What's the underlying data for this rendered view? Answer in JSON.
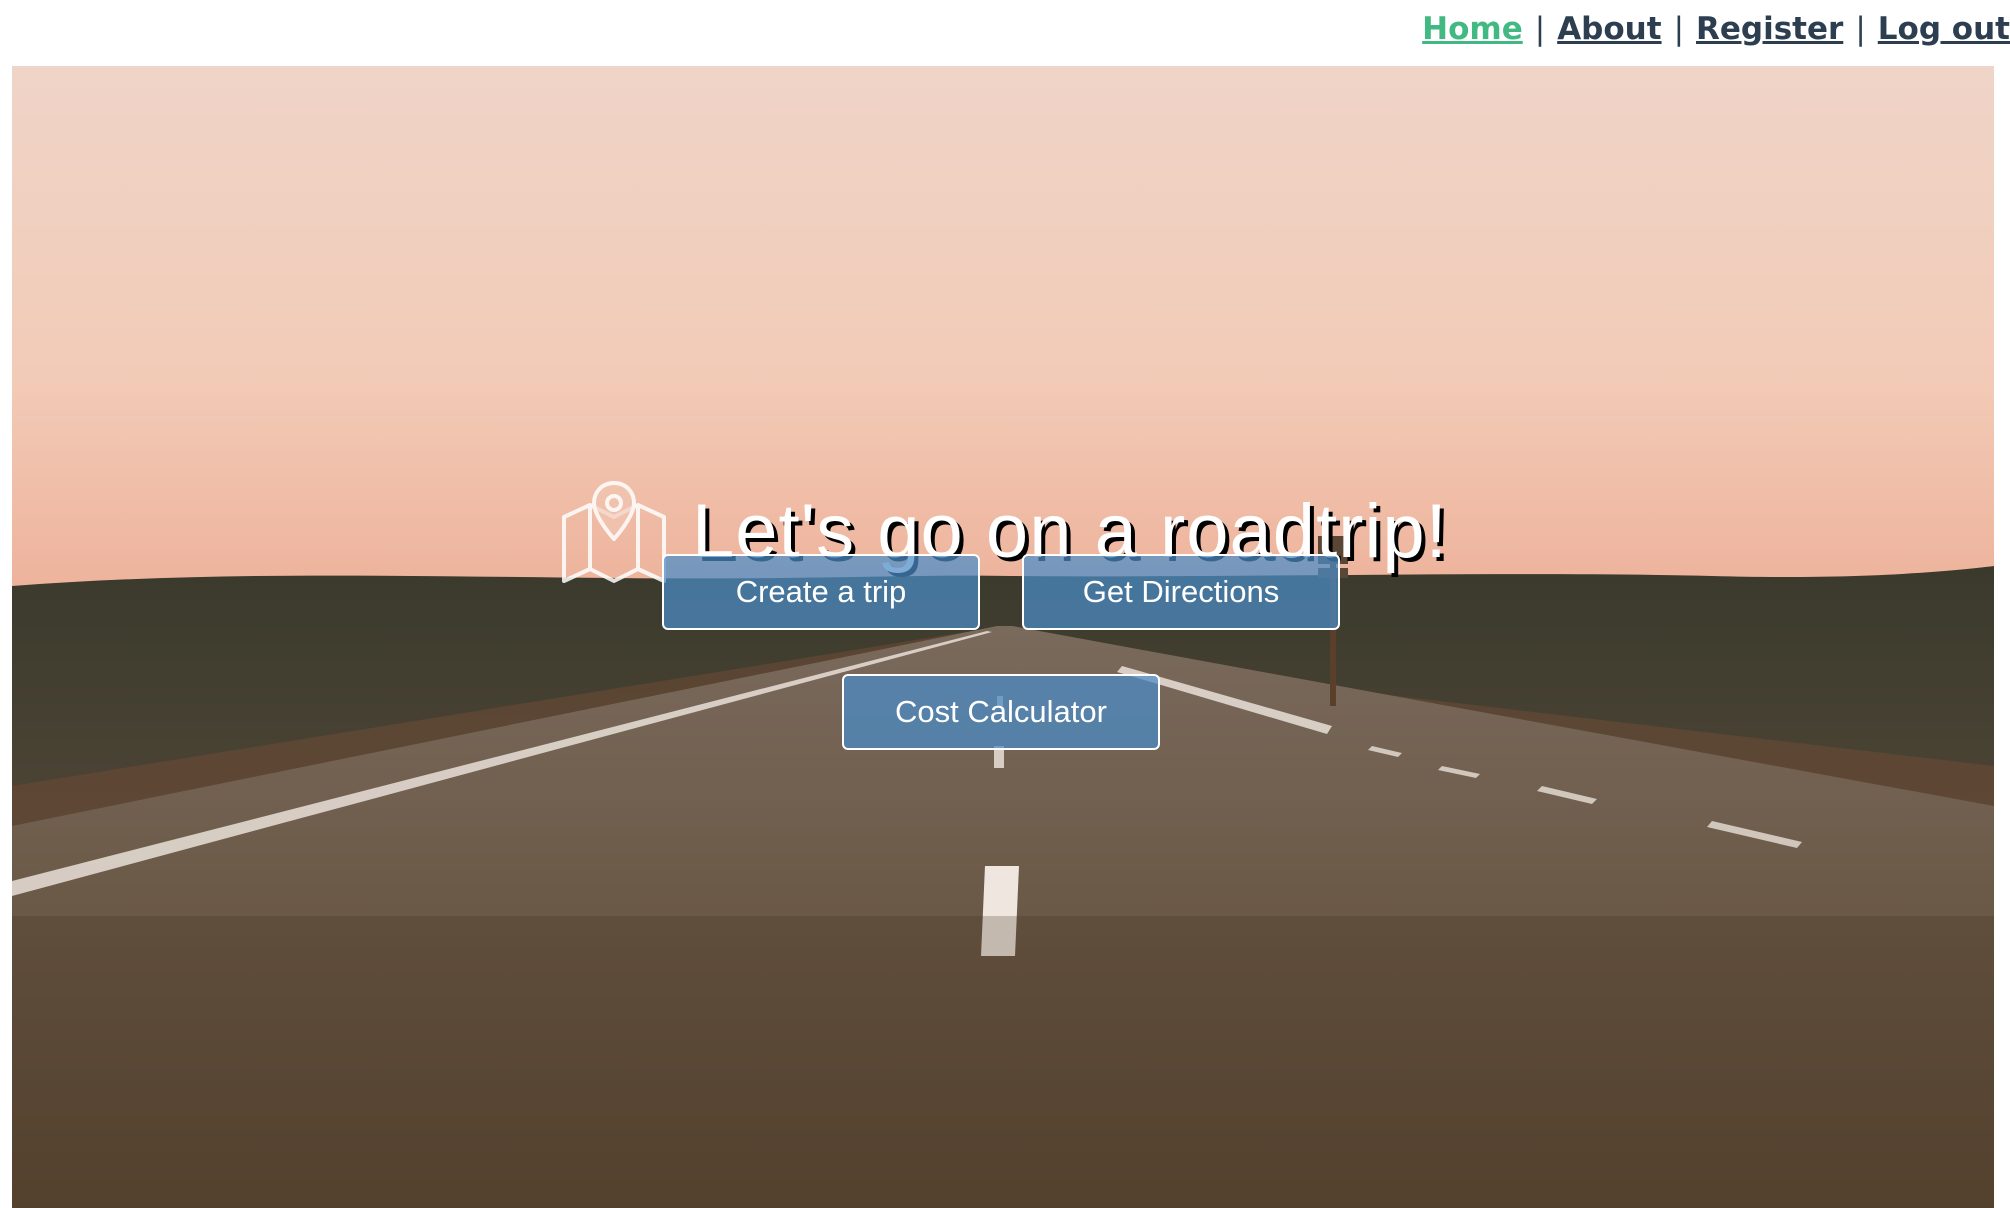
{
  "nav": {
    "items": [
      {
        "label": "Home",
        "active": true
      },
      {
        "label": "About",
        "active": false
      },
      {
        "label": "Register",
        "active": false
      },
      {
        "label": "Log out",
        "active": false
      }
    ],
    "separator": "|",
    "active_color": "#42b983",
    "text_color": "#2c3e50"
  },
  "hero": {
    "background": "roadtrip-road-photo",
    "title": "Let's go on a roadtrip!",
    "icon": "map-pin-icon",
    "buttons": {
      "create_trip": "Create a trip",
      "get_directions": "Get Directions",
      "cost_calculator": "Cost Calculator"
    },
    "button_color": "#4b8cc8"
  }
}
